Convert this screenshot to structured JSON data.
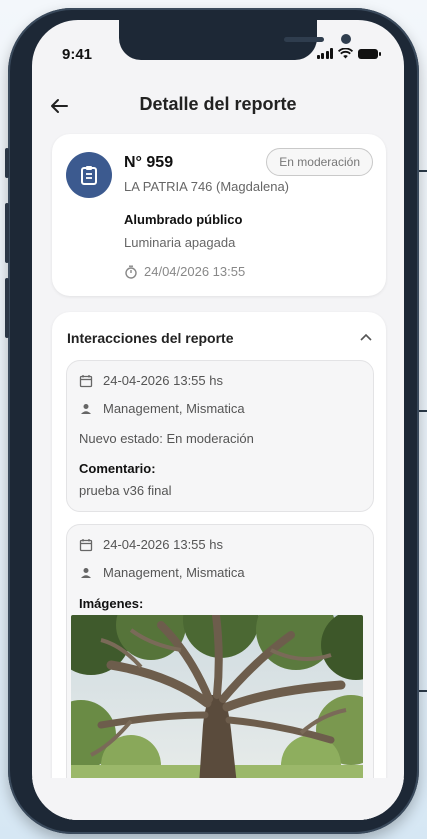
{
  "status_bar": {
    "time": "9:41"
  },
  "header": {
    "title": "Detalle del reporte",
    "back_icon": "arrow-left-icon"
  },
  "report": {
    "number": "N° 959",
    "status": "En moderación",
    "address": "LA PATRIA 746 (Magdalena)",
    "category": "Alumbrado público",
    "subcategory": "Luminaria apagada",
    "date": "24/04/2026 13:55"
  },
  "interactions": {
    "title": "Interacciones del reporte",
    "items": [
      {
        "date": "24-04-2026 13:55 hs",
        "user": "Management, Mismatica",
        "status_text": "Nuevo estado: En moderación",
        "comment_label": "Comentario:",
        "comment": "prueba v36 final"
      },
      {
        "date": "24-04-2026 13:55 hs",
        "user": "Management, Mismatica",
        "images_label": "Imágenes:"
      }
    ]
  },
  "colors": {
    "accent": "#3c5a8f",
    "frame": "#1d2836"
  }
}
